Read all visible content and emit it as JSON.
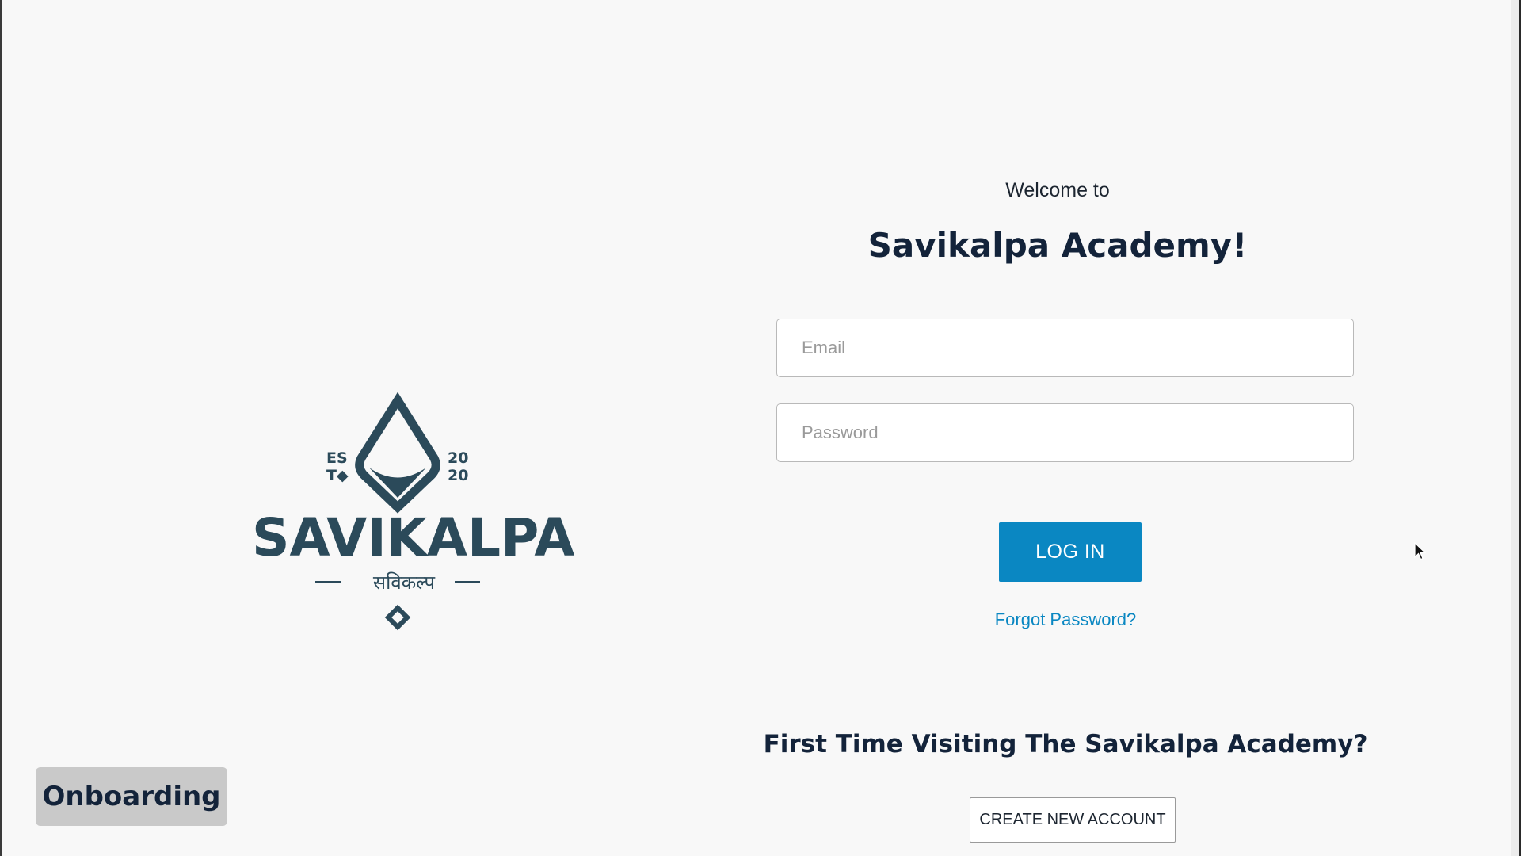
{
  "logo": {
    "est_left_top": "ES",
    "est_left_bottom": "T◆",
    "est_right_top": "20",
    "est_right_bottom": "20",
    "wordmark": "SAVIKALPA",
    "hindi": "सविकल्प",
    "icon": "savikalpa-crest-icon"
  },
  "login": {
    "welcome": "Welcome to",
    "title": "Savikalpa Academy!",
    "email_placeholder": "Email",
    "email_value": "",
    "password_placeholder": "Password",
    "password_value": "",
    "login_label": "LOG IN",
    "forgot_label": "Forgot Password?"
  },
  "signup": {
    "heading": "First Time Visiting The Savikalpa Academy?",
    "create_label": "CREATE NEW ACCOUNT"
  },
  "overlay": {
    "label": "Onboarding"
  },
  "colors": {
    "brand_dark": "#2b4a5a",
    "accent": "#0a87c2",
    "heading": "#13233a",
    "background": "#f8f8f8"
  }
}
